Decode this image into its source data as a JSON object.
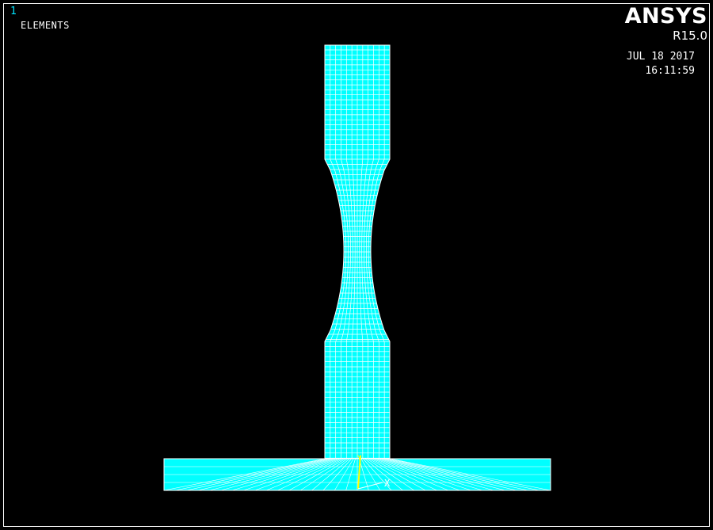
{
  "viewport": {
    "window_number": "1",
    "plot_title": "ELEMENTS"
  },
  "branding": {
    "product": "ANSYS",
    "version": "R15.0"
  },
  "timestamp": {
    "date": "JUL 18 2017",
    "time": "16:11:59"
  },
  "triad": {
    "x_label": "X",
    "y_label": "Y"
  },
  "colors": {
    "background": "#000000",
    "element_fill": "#00ffff",
    "mesh_lines": "#ffffff",
    "window_number": "#00e5ff",
    "triad_y": "#ffff00",
    "triad_x": "#ffffff"
  }
}
